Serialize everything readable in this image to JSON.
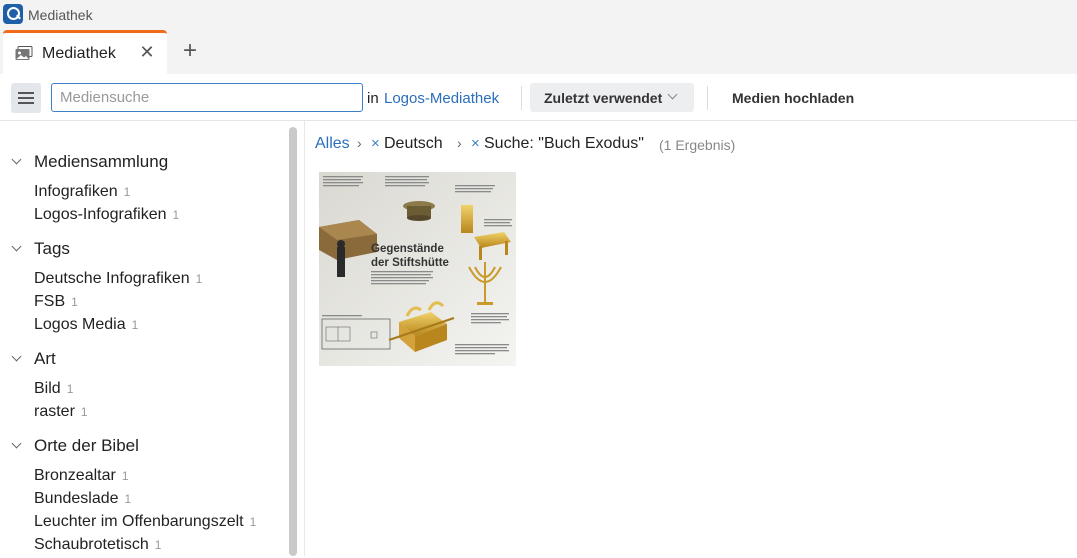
{
  "window": {
    "title": "Mediathek"
  },
  "tabs": [
    {
      "label": "Mediathek"
    }
  ],
  "toolbar": {
    "search_placeholder": "Mediensuche",
    "in_text": "in",
    "library_link": "Logos-Mediathek",
    "sort_label": "Zuletzt verwendet",
    "upload_label": "Medien hochladen"
  },
  "sidebar": {
    "groups": [
      {
        "label": "Mediensammlung",
        "items": [
          {
            "label": "Infografiken",
            "count": "1"
          },
          {
            "label": "Logos-Infografiken",
            "count": "1"
          }
        ]
      },
      {
        "label": "Tags",
        "items": [
          {
            "label": "Deutsche Infografiken",
            "count": "1"
          },
          {
            "label": "FSB",
            "count": "1"
          },
          {
            "label": "Logos Media",
            "count": "1"
          }
        ]
      },
      {
        "label": "Art",
        "items": [
          {
            "label": "Bild",
            "count": "1"
          },
          {
            "label": "raster",
            "count": "1"
          }
        ]
      },
      {
        "label": "Orte der Bibel",
        "items": [
          {
            "label": "Bronzealtar",
            "count": "1"
          },
          {
            "label": "Bundeslade",
            "count": "1"
          },
          {
            "label": "Leuchter im Offenbarungszelt",
            "count": "1"
          },
          {
            "label": "Schaubrotetisch",
            "count": "1"
          }
        ]
      }
    ]
  },
  "breadcrumb": {
    "all": "Alles",
    "filters": [
      "Deutsch",
      "Suche: \"Buch Exodus\""
    ],
    "result_count": "(1 Ergebnis)"
  },
  "results": [
    {
      "title": "Gegenstände der Stiftshütte"
    }
  ],
  "colors": {
    "accent": "#f26a1b",
    "link": "#2a6fbd",
    "focus": "#3a80c9"
  }
}
